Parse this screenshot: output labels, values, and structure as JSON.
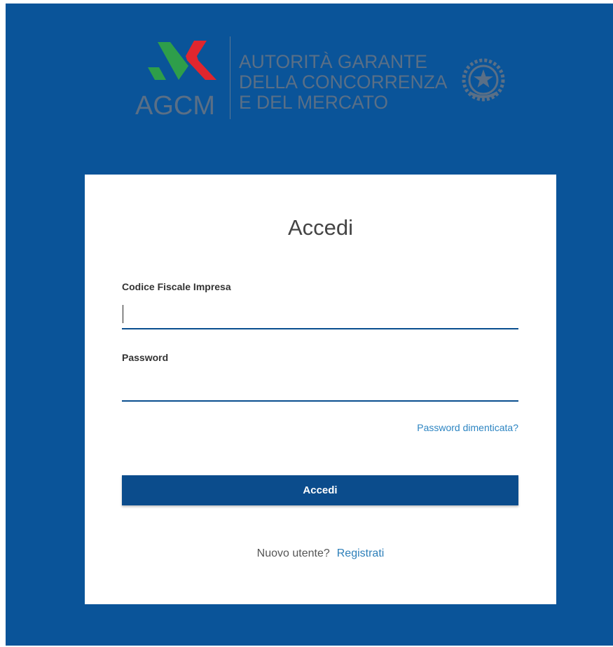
{
  "header": {
    "logo_acronym": "AGCM",
    "logo_name_lines": [
      "AUTORITÀ GARANTE",
      "DELLA CONCORRENZA",
      "E DEL MERCATO"
    ],
    "emblem_icon": "italian-republic-emblem-icon"
  },
  "login": {
    "title": "Accedi",
    "fiscal_code": {
      "label": "Codice Fiscale Impresa",
      "value": ""
    },
    "password": {
      "label": "Password",
      "value": ""
    },
    "forgot_password_link": "Password dimenticata?",
    "submit_label": "Accedi",
    "new_user_text": "Nuovo utente?",
    "register_link": "Registrati"
  },
  "colors": {
    "background_blue": "#0a5499",
    "button_blue": "#0b4c8c",
    "link_blue": "#2d85c2",
    "logo_green": "#2e9e4a",
    "logo_red": "#e0262e"
  }
}
